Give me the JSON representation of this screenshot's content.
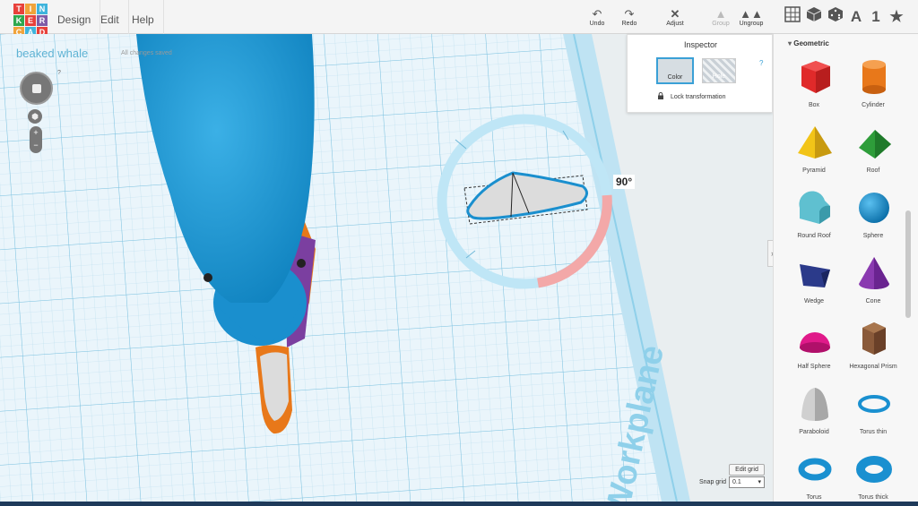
{
  "logo": {
    "letters": [
      "T",
      "I",
      "N",
      "K",
      "E",
      "R",
      "C",
      "A",
      "D"
    ],
    "colors": [
      "#e8413b",
      "#f0a33a",
      "#3fb4dc",
      "#2fa84f",
      "#e8413b",
      "#7f5ca7",
      "#f0a33a",
      "#3fb4dc",
      "#e8413b"
    ]
  },
  "menu": [
    "Design",
    "Edit",
    "Help"
  ],
  "toolbar": {
    "undo": {
      "label": "Undo",
      "icon": "undo-icon"
    },
    "redo": {
      "label": "Redo",
      "icon": "redo-icon"
    },
    "adjust": {
      "label": "Adjust",
      "icon": "adjust-icon"
    },
    "group": {
      "label": "Group",
      "icon": "group-icon"
    },
    "ungroup": {
      "label": "Ungroup",
      "icon": "ungroup-icon"
    }
  },
  "view_buttons": {
    "text_icon": "A",
    "number_icon": "1"
  },
  "project": {
    "name": "beaked whale",
    "save_status": "All changes saved"
  },
  "canvas": {
    "help": "?",
    "rotation": "90°",
    "workplane_label": "Workplane",
    "edit_grid": "Edit grid",
    "snap_grid_label": "Snap grid",
    "snap_grid_value": "0.1"
  },
  "inspector": {
    "title": "Inspector",
    "color_label": "Color",
    "hole_label": "Hole",
    "help": "?",
    "lock_label": "Lock transformation"
  },
  "sidebar": {
    "category": "Geometric",
    "shapes": [
      {
        "label": "Box",
        "color": "#e02a2a"
      },
      {
        "label": "Cylinder",
        "color": "#e8781a"
      },
      {
        "label": "Pyramid",
        "color": "#f2c418"
      },
      {
        "label": "Roof",
        "color": "#2e9d3a"
      },
      {
        "label": "Round Roof",
        "color": "#5fc0d0"
      },
      {
        "label": "Sphere",
        "color": "#1a90d0"
      },
      {
        "label": "Wedge",
        "color": "#2b3a8a"
      },
      {
        "label": "Cone",
        "color": "#8a3ab0"
      },
      {
        "label": "Half Sphere",
        "color": "#e01a8a"
      },
      {
        "label": "Hexagonal Prism",
        "color": "#8a5a3a"
      },
      {
        "label": "Paraboloid",
        "color": "#d0d0d0"
      },
      {
        "label": "Torus thin",
        "color": "#1a90d0"
      },
      {
        "label": "Torus",
        "color": "#1a90d0"
      },
      {
        "label": "Torus thick",
        "color": "#1a90d0"
      }
    ]
  }
}
